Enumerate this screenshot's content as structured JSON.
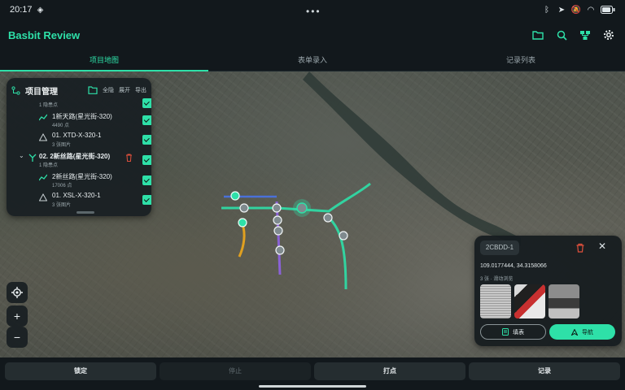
{
  "status": {
    "time": "20:17",
    "dots": "•••"
  },
  "app": {
    "title": "Basbit Review"
  },
  "tabs": [
    {
      "label": "项目地图",
      "active": true
    },
    {
      "label": "表单录入",
      "active": false
    },
    {
      "label": "记录列表",
      "active": false
    }
  ],
  "panel": {
    "title": "项目管理",
    "actions": {
      "all": "全隐",
      "expand": "展开",
      "export": "导出"
    },
    "rows": [
      {
        "title": "",
        "sub": "1 隐患点",
        "kind": "summary"
      },
      {
        "title": "1新天路(星光街-320)",
        "sub": "4490 点",
        "kind": "track"
      },
      {
        "title": "01. XTD-X-320-1",
        "sub": "3 张图片",
        "kind": "point"
      },
      {
        "title": "02. 2新丝路(星光街-320)",
        "sub": "1 隐患点",
        "kind": "project"
      },
      {
        "title": "2新丝路(星光街-320)",
        "sub": "17006 点",
        "kind": "track"
      },
      {
        "title": "01. XSL-X-320-1",
        "sub": "3 张图片",
        "kind": "point"
      }
    ]
  },
  "map_controls": {
    "locate": "locate",
    "zoom_in": "+",
    "zoom_out": "−"
  },
  "info": {
    "code": "2CBDD-1",
    "coord": "109.0177444, 34.3158066",
    "photos": "3 张 · 滑动浏览",
    "fill_label": "填表",
    "nav_label": "导航"
  },
  "bottom": {
    "lock": "锁定",
    "stop": "停止",
    "mark": "打点",
    "record": "记录"
  },
  "colors": {
    "accent": "#2ee0a8",
    "route_purple": "#8a62d6",
    "route_orange": "#e0a020",
    "route_blue": "#4a70d8"
  }
}
